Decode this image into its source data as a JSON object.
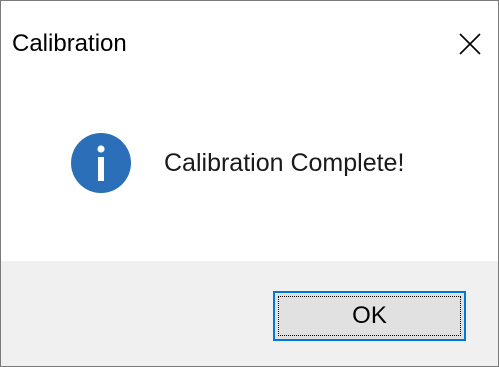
{
  "window": {
    "title": "Calibration",
    "close_icon": "close-icon"
  },
  "message": {
    "icon": "info-icon",
    "text": "Calibration Complete!"
  },
  "buttons": {
    "ok_label": "OK"
  },
  "colors": {
    "info_icon": "#2a6fb8",
    "button_focus_border": "#0078d7",
    "button_face": "#e1e1e1",
    "footer_bg": "#f0f0f0"
  }
}
